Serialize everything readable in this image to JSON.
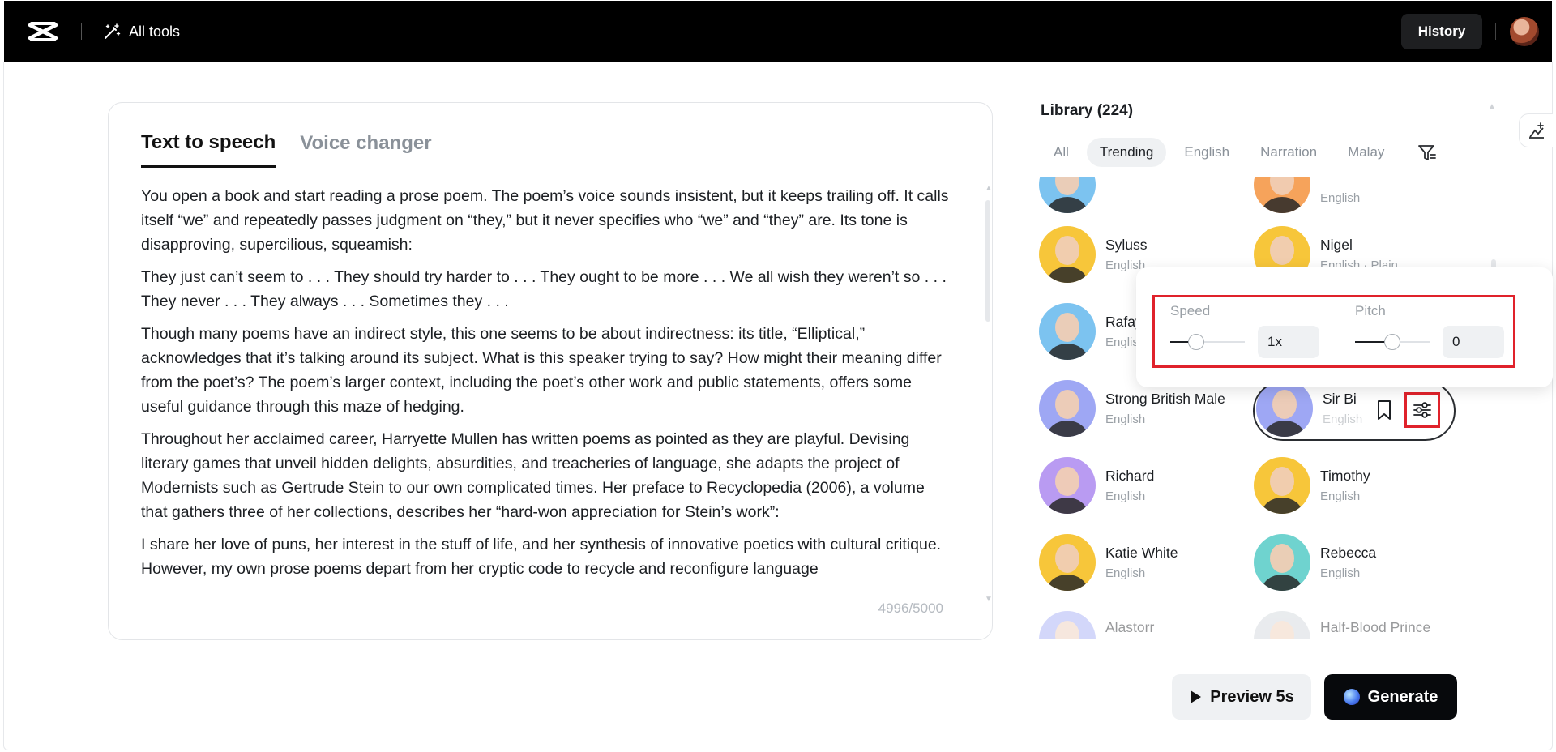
{
  "topbar": {
    "all_tools_label": "All tools",
    "history_label": "History"
  },
  "editor": {
    "tabs": [
      {
        "label": "Text to speech",
        "active": true
      },
      {
        "label": "Voice changer",
        "active": false
      }
    ],
    "paragraphs": [
      "You open a book and start reading a prose poem. The poem’s voice sounds insistent, but it keeps trailing off. It calls itself “we” and repeatedly passes judgment on “they,” but it never specifies who “we” and “they” are. Its tone is disapproving, supercilious, squeamish:",
      "They just can’t seem to . . . They should try harder to . . . They ought to be more . . . We all wish they weren’t so . . . They never . . . They always . . . Sometimes they . . .",
      "Though many poems have an indirect style, this one seems to be about indirectness: its title, “Elliptical,” acknowledges that it’s talking around its subject. What is this speaker trying to say? How might their meaning differ from the poet’s? The poem’s larger context, including the poet’s other work and public statements, offers some useful guidance through this maze of hedging.",
      "Throughout her acclaimed career, Harryette Mullen has written poems as pointed as they are playful. Devising literary games that unveil hidden delights, absurdities, and treacheries of language, she adapts the project of Modernists such as Gertrude Stein to our own complicated times. Her preface to Recyclopedia (2006), a volume that gathers three of her collections, describes her “hard-won appreciation for Stein’s work”:",
      "I share her love of puns, her interest in the stuff of life, and her synthesis of innovative poetics with cultural critique. However, my own prose poems depart from her cryptic code to recycle and reconfigure language"
    ],
    "char_count": "4996/5000"
  },
  "library": {
    "title": "Library (224)",
    "filters": [
      {
        "label": "All",
        "active": false
      },
      {
        "label": "Trending",
        "active": true
      },
      {
        "label": "English",
        "active": false
      },
      {
        "label": "Narration",
        "active": false
      },
      {
        "label": "Malay",
        "active": false
      }
    ],
    "voices": [
      {
        "name": "",
        "lang": "",
        "color": "#7cc3f0"
      },
      {
        "name": "",
        "lang": "English",
        "color": "#f6a35b"
      },
      {
        "name": "Syluss",
        "lang": "English",
        "color": "#f7c63a"
      },
      {
        "name": "Nigel",
        "lang": "English · Plain",
        "color": "#f7c63a"
      },
      {
        "name": "Rafay",
        "lang": "English",
        "color": "#7cc3f0"
      },
      {
        "name": "Sir Bi",
        "lang": "English",
        "color": "#9ea7f4"
      },
      {
        "name": "Strong British Male",
        "lang": "English",
        "color": "#9ea7f4"
      },
      {
        "name": "Richard",
        "lang": "English",
        "color": "#b99bf2"
      },
      {
        "name": "Timothy",
        "lang": "English",
        "color": "#f7c63a"
      },
      {
        "name": "Katie White",
        "lang": "English",
        "color": "#f7c63a"
      },
      {
        "name": "Rebecca",
        "lang": "English",
        "color": "#6fd3cf"
      },
      {
        "name": "Alastorr",
        "lang": "",
        "color": "#9ea7f4"
      },
      {
        "name": "Half-Blood Prince",
        "lang": "",
        "color": "#cfd4da"
      }
    ]
  },
  "popover": {
    "speed_label": "Speed",
    "speed_value": "1x",
    "speed_level": 0.35,
    "pitch_label": "Pitch",
    "pitch_value": "0",
    "pitch_level": 0.5
  },
  "actions": {
    "preview_label": "Preview 5s",
    "generate_label": "Generate"
  }
}
